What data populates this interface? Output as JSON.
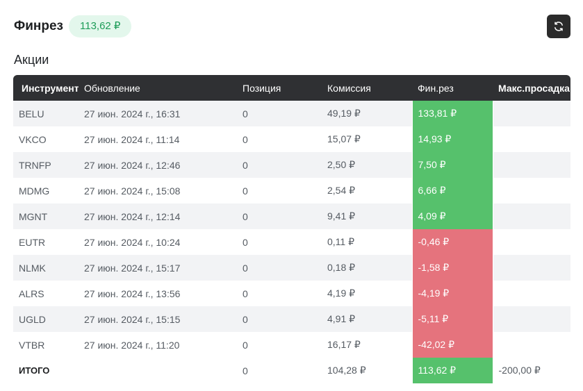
{
  "header": {
    "title": "Финрез",
    "total": "113,62 ₽"
  },
  "section_title": "Акции",
  "columns": [
    "Инструмент",
    "Обновление",
    "Позиция",
    "Комиссия",
    "Фин.рез",
    "Макс.просадка"
  ],
  "rows": [
    {
      "instrument": "BELU",
      "updated": "27 июн. 2024 г., 16:31",
      "position": "0",
      "commission": "49,19 ₽",
      "pnl": "133,81 ₽",
      "pnl_sign": "pos",
      "drawdown": ""
    },
    {
      "instrument": "VKCO",
      "updated": "27 июн. 2024 г., 11:14",
      "position": "0",
      "commission": "15,07 ₽",
      "pnl": "14,93 ₽",
      "pnl_sign": "pos",
      "drawdown": ""
    },
    {
      "instrument": "TRNFP",
      "updated": "27 июн. 2024 г., 12:46",
      "position": "0",
      "commission": "2,50 ₽",
      "pnl": "7,50 ₽",
      "pnl_sign": "pos",
      "drawdown": ""
    },
    {
      "instrument": "MDMG",
      "updated": "27 июн. 2024 г., 15:08",
      "position": "0",
      "commission": "2,54 ₽",
      "pnl": "6,66 ₽",
      "pnl_sign": "pos",
      "drawdown": ""
    },
    {
      "instrument": "MGNT",
      "updated": "27 июн. 2024 г., 12:14",
      "position": "0",
      "commission": "9,41 ₽",
      "pnl": "4,09 ₽",
      "pnl_sign": "pos",
      "drawdown": ""
    },
    {
      "instrument": "EUTR",
      "updated": "27 июн. 2024 г., 10:24",
      "position": "0",
      "commission": "0,11 ₽",
      "pnl": "-0,46 ₽",
      "pnl_sign": "neg",
      "drawdown": ""
    },
    {
      "instrument": "NLMK",
      "updated": "27 июн. 2024 г., 15:17",
      "position": "0",
      "commission": "0,18 ₽",
      "pnl": "-1,58 ₽",
      "pnl_sign": "neg",
      "drawdown": ""
    },
    {
      "instrument": "ALRS",
      "updated": "27 июн. 2024 г., 13:56",
      "position": "0",
      "commission": "4,19 ₽",
      "pnl": "-4,19 ₽",
      "pnl_sign": "neg",
      "drawdown": ""
    },
    {
      "instrument": "UGLD",
      "updated": "27 июн. 2024 г., 15:15",
      "position": "0",
      "commission": "4,91 ₽",
      "pnl": "-5,11 ₽",
      "pnl_sign": "neg",
      "drawdown": ""
    },
    {
      "instrument": "VTBR",
      "updated": "27 июн. 2024 г., 11:20",
      "position": "0",
      "commission": "16,17 ₽",
      "pnl": "-42,02 ₽",
      "pnl_sign": "neg",
      "drawdown": ""
    }
  ],
  "total_row": {
    "label": "ИТОГО",
    "position": "0",
    "commission": "104,28 ₽",
    "pnl": "113,62 ₽",
    "drawdown": "-200,00 ₽"
  },
  "icons": {
    "refresh": "refresh-icon"
  },
  "colors": {
    "positive": "#56c16c",
    "negative": "#e5737d",
    "header_bg": "#2f3033",
    "pill_bg": "#e3f7ec",
    "pill_text": "#1d9c58"
  }
}
